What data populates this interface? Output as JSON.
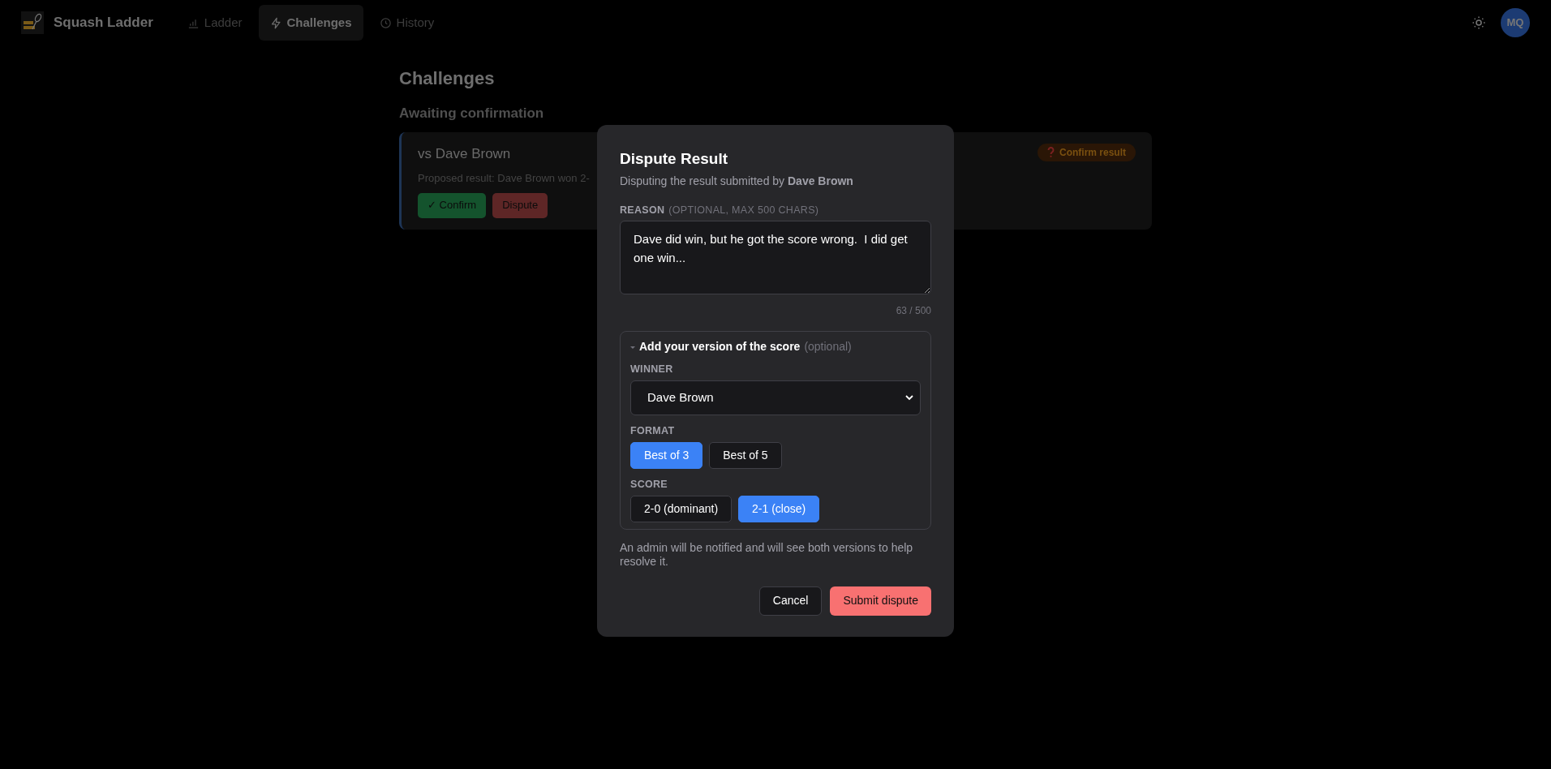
{
  "app": {
    "title": "Squash Ladder",
    "avatar": "MQ"
  },
  "nav": [
    {
      "label": "Ladder",
      "kind": "bars",
      "selected": false
    },
    {
      "label": "Challenges",
      "kind": "bolt",
      "selected": true
    },
    {
      "label": "History",
      "kind": "clock",
      "selected": false
    }
  ],
  "page": {
    "title": "Challenges",
    "section": "Awaiting confirmation",
    "card": {
      "opponent": "vs Dave Brown",
      "proposed": "Proposed result: Dave Brown won 2-",
      "badge": "Confirm result",
      "buttons": [
        {
          "label": "✓ Confirm",
          "kind": "confirm"
        },
        {
          "label": "Dispute",
          "kind": "dispute"
        }
      ]
    }
  },
  "dialog": {
    "title": "Dispute Result",
    "subtitle": "Disputing the result submitted by **Dave Brown**",
    "reason_label": "REASON",
    "reason_hint": "(OPTIONAL, MAX 500 CHARS)",
    "reason_value": "Dave did win, but he got the score wrong.  I did get one win...",
    "counter": "63 / 500",
    "score_section": {
      "title": "Add your version of the score",
      "hint": "(optional)",
      "expanded": true,
      "winner_label": "WINNER",
      "winner": "Dave Brown",
      "format_label": "FORMAT",
      "formats": [
        {
          "label": "Best of 3",
          "selected": true
        },
        {
          "label": "Best of 5",
          "selected": false
        }
      ],
      "score_label": "SCORE",
      "scores": [
        {
          "label": "2-0 (dominant)",
          "selected": false
        },
        {
          "label": "2-1 (close)",
          "selected": true
        }
      ]
    },
    "note": "An admin will be notified and will see both versions to help resolve it.",
    "buttons": [
      {
        "label": "Cancel",
        "kind": "secondary"
      },
      {
        "label": "Submit dispute",
        "kind": "danger"
      }
    ]
  }
}
